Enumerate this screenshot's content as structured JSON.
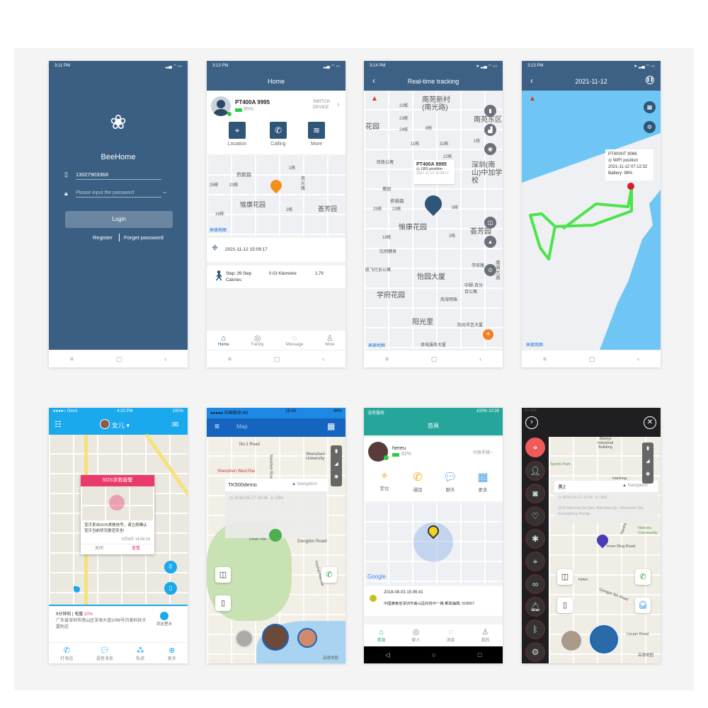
{
  "login": {
    "time": "3:11 PM",
    "app_name": "BeeHome",
    "phone_value": "13027903368",
    "password_placeholder": "Please input the password",
    "login_label": "Login",
    "register_label": "Register",
    "forget_label": "Forget password"
  },
  "home": {
    "time": "3:13 PM",
    "title": "Home",
    "device_name": "PT400A 9995",
    "battery": "95%",
    "switch_label": "SWITCH DEVICE",
    "actions": [
      "Location",
      "Calling",
      "More"
    ],
    "map_labels": [
      "侨新路",
      "愉康花园",
      "荟芳园",
      "南光路",
      "25栋",
      "23栋",
      "16栋",
      "1栋",
      "2栋"
    ],
    "map_logo": "高德地图",
    "location_time": "2021-11-12 15:09:17",
    "step": "Step: 39 Step",
    "km": "0.03 Kilometre",
    "cal_value": "1.79",
    "calories_label": "Calories",
    "tabs": [
      "Home",
      "Family",
      "Message",
      "Mine"
    ]
  },
  "tracking": {
    "time": "3:14 PM",
    "title": "Real-time tracking",
    "device_name": "PT400A 9995",
    "position_type": "LBS position",
    "timestamp": "2021-11-12 15:09:17",
    "map_labels": [
      "南苑新村(南光路)",
      "南苑东区",
      "花园",
      "深圳(南山)中加学校",
      "民政公寓",
      "豪园",
      "侨新路",
      "愉康花园",
      "荟芳园",
      "比例健身",
      "航飞行员公寓",
      "怡园大厦",
      "学府花园",
      "阳光里",
      "南海大道",
      "学府路",
      "中颐·百分百公寓",
      "南海明珠",
      "阳光华艺大厦",
      "供电服务大厦",
      "22栋",
      "23栋",
      "24栋",
      "8栋",
      "11栋",
      "32栋",
      "22栋",
      "1栋",
      "5栋",
      "2栋",
      "16栋",
      "25栋",
      "23栋"
    ],
    "map_logo": "高德地图"
  },
  "history": {
    "time": "3:13 PM",
    "title": "2021-11-12",
    "device_name": "PT400HT 9086",
    "position_type": "WIFI position",
    "timestamp": "2021-11-12 07:12:32",
    "battery": "Battery: 98%",
    "map_logo": "高德地图",
    "track_color": "#4de34a",
    "water_color": "#6fc6f4"
  },
  "sos": {
    "carrier": "Omni",
    "time": "4:20 PM",
    "battery": "100%",
    "user": "女儿",
    "alert_title": "SOS求救报警",
    "alert_text": "宝贝发出SOS求救信号，请立即确认宝贝当前状况是否安全!",
    "alert_time": "5月9日  14:00:19",
    "close_label": "关闭",
    "view_label": "查看",
    "info_ago": "9分钟前 | 电量:",
    "info_battery": "10%",
    "address": "广东省深圳市南山区深海大道1098号讯美科技大厦附近",
    "go_label": "到这里去",
    "tabs": [
      "打电话",
      "语音消息",
      "轨迹",
      "更多"
    ],
    "accent": "#1aa9ec"
  },
  "map6": {
    "carrier": "中国移动  4G",
    "time": "15:40",
    "battery": "44%",
    "title": "Map",
    "device_name": "TK500demo",
    "nav_label": "Navigation",
    "timestamp": "2016-05-27 15:36",
    "position_type": "LBS",
    "map_labels": [
      "No.1 Road",
      "Shenzhen University",
      "Shenzhen West Rai",
      "Inner Rin",
      "Dongbin Road",
      "Houhai Avenue",
      "Nanshan Road"
    ],
    "map_logo": "高德地图",
    "accent": "#1565c0"
  },
  "cn_home": {
    "status": "没有服务",
    "time": "10:39",
    "battery": "100%",
    "title": "首頁",
    "user": "hereu",
    "battery_level": "62%",
    "switch_label": "切換手錶",
    "actions": [
      "定位",
      "通話",
      "聊天",
      "更多"
    ],
    "map_logo": "Google",
    "timestamp": "2018-08-03 15:06:41",
    "address": "中國廣東省深圳市南山區科技中一路 郵政編碼: 518057",
    "tabs": [
      "首頁",
      "家人",
      "消息",
      "我的"
    ],
    "accent": "#26a69a"
  },
  "dark": {
    "status": "No SIM",
    "device_name": "黑2",
    "nav_label": "Navigation",
    "timestamp": "2016-04-27 11:00",
    "position_type": "LBS",
    "address": "1123 Nan Hai Da Dao, Nanshan Qu, Shenzhen Shi, Guangdong Sheng...",
    "map_labels": [
      "Shenyi Industrial Building",
      "Sports Park",
      "Hanking",
      "Inner Ring Road",
      "Gongye 8th Road",
      "Liyuan Road",
      "Nanyou Community",
      "Nanhai A",
      "Hotel"
    ],
    "map_logo": "高德地图"
  }
}
